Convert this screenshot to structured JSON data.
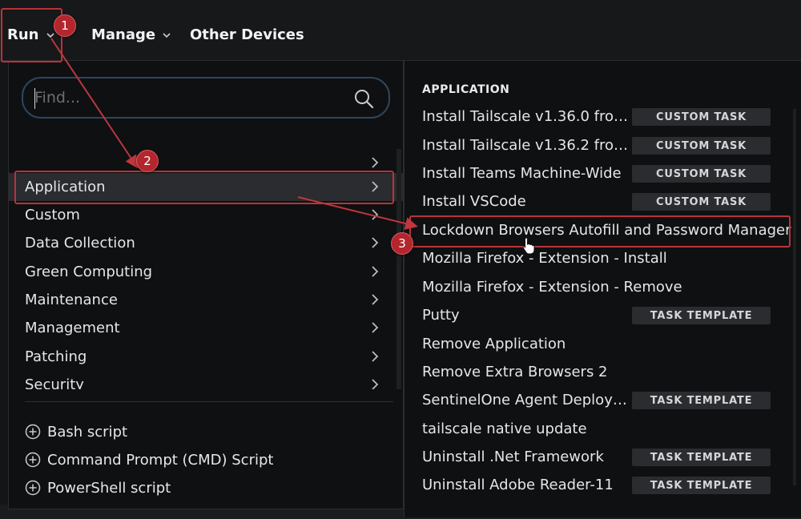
{
  "topbar": {
    "run": "Run",
    "manage": "Manage",
    "other_devices": "Other Devices"
  },
  "search": {
    "placeholder": "Find..."
  },
  "menu": {
    "items": [
      {
        "label": ""
      },
      {
        "label": "Application"
      },
      {
        "label": "Custom"
      },
      {
        "label": "Data Collection"
      },
      {
        "label": "Green Computing"
      },
      {
        "label": "Maintenance"
      },
      {
        "label": "Management"
      },
      {
        "label": "Patching"
      },
      {
        "label": "Security"
      }
    ],
    "scripts": [
      {
        "label": "Bash script"
      },
      {
        "label": "Command Prompt (CMD) Script"
      },
      {
        "label": "PowerShell script"
      }
    ]
  },
  "submenu": {
    "header": "APPLICATION",
    "tasks": [
      {
        "name": "Install Tailscale v1.36.0 from ...",
        "badge": "CUSTOM TASK"
      },
      {
        "name": "Install Tailscale v1.36.2 from ...",
        "badge": "CUSTOM TASK"
      },
      {
        "name": "Install Teams Machine-Wide",
        "badge": "CUSTOM TASK"
      },
      {
        "name": "Install VSCode",
        "badge": "CUSTOM TASK"
      },
      {
        "name": "Lockdown Browsers Autofill and Password Manager",
        "badge": ""
      },
      {
        "name": "Mozilla Firefox - Extension - Install",
        "badge": ""
      },
      {
        "name": "Mozilla Firefox - Extension - Remove",
        "badge": ""
      },
      {
        "name": "Putty",
        "badge": "TASK TEMPLATE"
      },
      {
        "name": "Remove Application",
        "badge": ""
      },
      {
        "name": "Remove Extra Browsers 2",
        "badge": ""
      },
      {
        "name": "SentinelOne Agent Deploym...",
        "badge": "TASK TEMPLATE"
      },
      {
        "name": "tailscale native update",
        "badge": ""
      },
      {
        "name": "Uninstall .Net Framework",
        "badge": "TASK TEMPLATE"
      },
      {
        "name": "Uninstall Adobe Reader-11",
        "badge": "TASK TEMPLATE"
      }
    ]
  },
  "annotations": {
    "step1": "1",
    "step2": "2",
    "step3": "3",
    "color": "#b8333a"
  },
  "icons": {
    "search": "search-icon",
    "chevron": "chevron-right-icon",
    "plus": "plus-circle-icon"
  }
}
